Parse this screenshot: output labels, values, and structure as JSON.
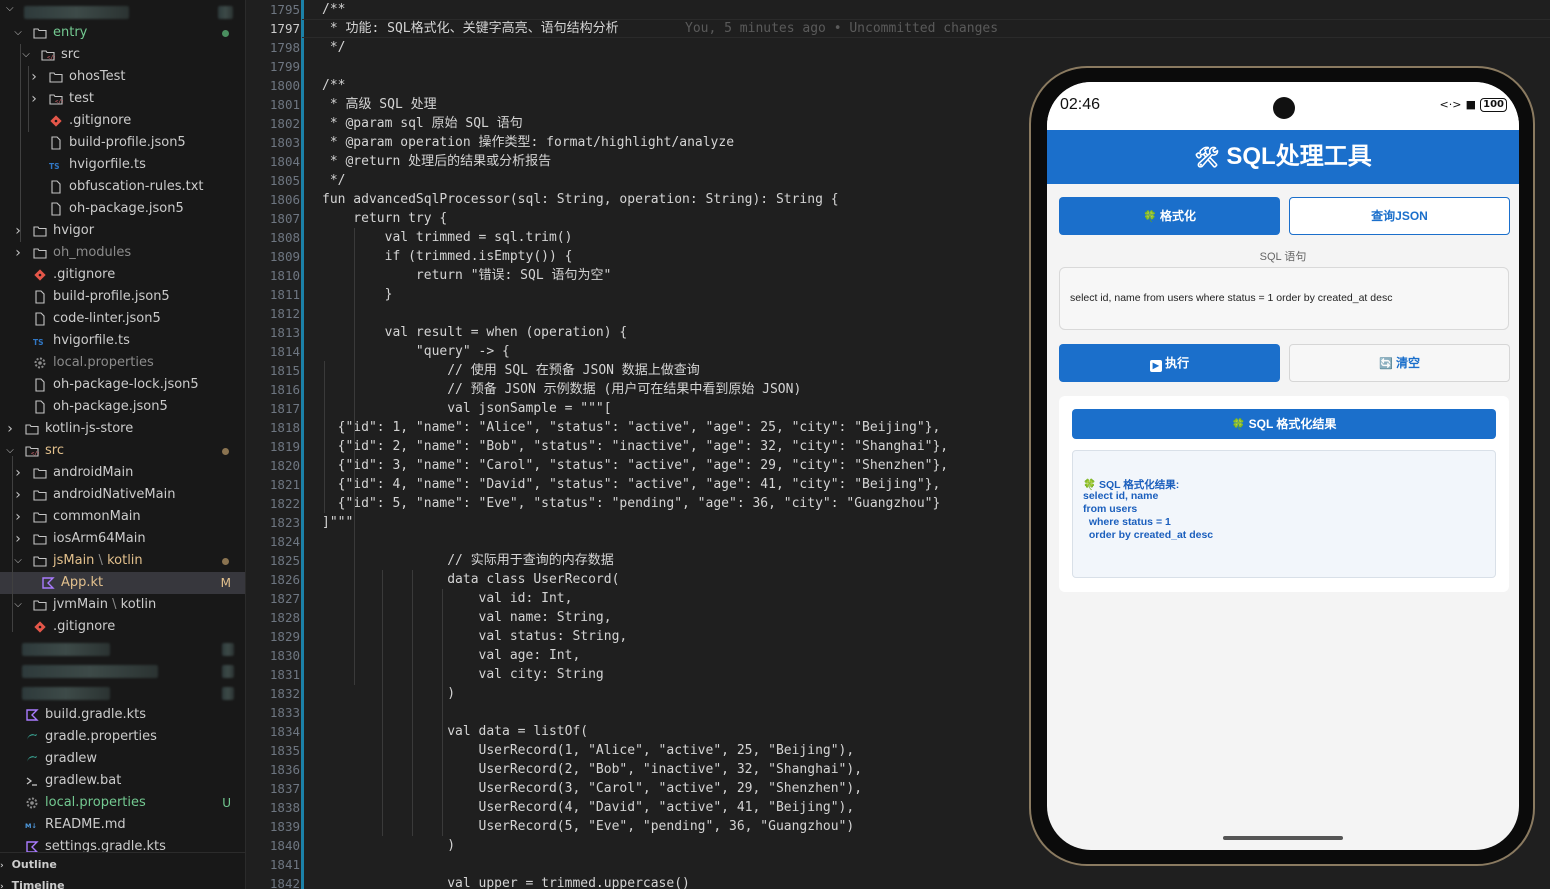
{
  "explorer": {
    "items": [
      {
        "label": "entry",
        "level": 1,
        "type": "folder",
        "expanded": true,
        "color": "#73c991",
        "status": "dot",
        "status_color": "#4a8f5f"
      },
      {
        "label": "src",
        "level": 2,
        "type": "src-folder",
        "expanded": true
      },
      {
        "label": "ohosTest",
        "level": 3,
        "type": "folder",
        "expanded": false
      },
      {
        "label": "test",
        "level": 3,
        "type": "src-folder",
        "expanded": false
      },
      {
        "label": ".gitignore",
        "level": 3,
        "type": "git"
      },
      {
        "label": "build-profile.json5",
        "level": 3,
        "type": "file"
      },
      {
        "label": "hvigorfile.ts",
        "level": 3,
        "type": "ts"
      },
      {
        "label": "obfuscation-rules.txt",
        "level": 3,
        "type": "file"
      },
      {
        "label": "oh-package.json5",
        "level": 3,
        "type": "file"
      },
      {
        "label": "hvigor",
        "level": 1,
        "type": "folder",
        "expanded": false
      },
      {
        "label": "oh_modules",
        "level": 1,
        "type": "folder",
        "expanded": false,
        "color": "#8b8b8b"
      },
      {
        "label": ".gitignore",
        "level": 1,
        "type": "git"
      },
      {
        "label": "build-profile.json5",
        "level": 1,
        "type": "file"
      },
      {
        "label": "code-linter.json5",
        "level": 1,
        "type": "file"
      },
      {
        "label": "hvigorfile.ts",
        "level": 1,
        "type": "ts"
      },
      {
        "label": "local.properties",
        "level": 1,
        "type": "gear",
        "color": "#8b8b8b"
      },
      {
        "label": "oh-package-lock.json5",
        "level": 1,
        "type": "file"
      },
      {
        "label": "oh-package.json5",
        "level": 1,
        "type": "file"
      },
      {
        "label": "kotlin-js-store",
        "level": 0,
        "type": "folder",
        "expanded": false
      },
      {
        "label": "src",
        "level": 0,
        "type": "src-folder",
        "expanded": true,
        "color": "#e2c08d",
        "status": "dot",
        "status_color": "#8a7350"
      },
      {
        "label": "androidMain",
        "level": 1,
        "type": "folder",
        "expanded": false
      },
      {
        "label": "androidNativeMain",
        "level": 1,
        "type": "folder",
        "expanded": false
      },
      {
        "label": "commonMain",
        "level": 1,
        "type": "folder",
        "expanded": false
      },
      {
        "label": "iosArm64Main",
        "level": 1,
        "type": "folder",
        "expanded": false
      },
      {
        "label": "jsMain",
        "label2": "kotlin",
        "level": 1,
        "type": "folder",
        "expanded": true,
        "color": "#e2c08d",
        "status": "dot",
        "status_color": "#8a7350"
      },
      {
        "label": "App.kt",
        "level": 2,
        "type": "kotlin",
        "selected": true,
        "color": "#e2c08d",
        "status": "M",
        "status_color": "#e2c08d"
      },
      {
        "label": "jvmMain",
        "label2": "kotlin",
        "level": 1,
        "type": "folder",
        "expanded": true
      },
      {
        "label": ".gitignore",
        "level": 1,
        "type": "git"
      },
      {
        "label": "",
        "level": 0,
        "type": "blurred"
      },
      {
        "label": "",
        "level": 0,
        "type": "blurred"
      },
      {
        "label": "",
        "level": 0,
        "type": "blurred"
      },
      {
        "label": "build.gradle.kts",
        "level": 0,
        "type": "kotlin"
      },
      {
        "label": "gradle.properties",
        "level": 0,
        "type": "gradle"
      },
      {
        "label": "gradlew",
        "level": 0,
        "type": "gradle"
      },
      {
        "label": "gradlew.bat",
        "level": 0,
        "type": "terminal"
      },
      {
        "label": "local.properties",
        "level": 0,
        "type": "gear",
        "color": "#73c991",
        "status": "U",
        "status_color": "#73c991"
      },
      {
        "label": "README.md",
        "level": 0,
        "type": "md"
      },
      {
        "label": "settings.gradle.kts",
        "level": 0,
        "type": "kotlin"
      }
    ],
    "panels": [
      "Outline",
      "Timeline"
    ]
  },
  "editor": {
    "current_line": "1797",
    "blame": "You, 5 minutes ago • Uncommitted changes",
    "lines": [
      {
        "n": "1795",
        "t": "/**"
      },
      {
        "n": "1797",
        "t": " * 功能: SQL格式化、关键字高亮、语句结构分析"
      },
      {
        "n": "1798",
        "t": " */"
      },
      {
        "n": "1799",
        "t": ""
      },
      {
        "n": "1800",
        "t": "/**"
      },
      {
        "n": "1801",
        "t": " * 高级 SQL 处理"
      },
      {
        "n": "1802",
        "t": " * @param sql 原始 SQL 语句"
      },
      {
        "n": "1803",
        "t": " * @param operation 操作类型: format/highlight/analyze"
      },
      {
        "n": "1804",
        "t": " * @return 处理后的结果或分析报告"
      },
      {
        "n": "1805",
        "t": " */"
      },
      {
        "n": "1806",
        "t": "fun advancedSqlProcessor(sql: String, operation: String): String {"
      },
      {
        "n": "1807",
        "t": "    return try {"
      },
      {
        "n": "1808",
        "t": "        val trimmed = sql.trim()"
      },
      {
        "n": "1809",
        "t": "        if (trimmed.isEmpty()) {"
      },
      {
        "n": "1810",
        "t": "            return \"错误: SQL 语句为空\""
      },
      {
        "n": "1811",
        "t": "        }"
      },
      {
        "n": "1812",
        "t": ""
      },
      {
        "n": "1813",
        "t": "        val result = when (operation) {"
      },
      {
        "n": "1814",
        "t": "            \"query\" -> {"
      },
      {
        "n": "1815",
        "t": "                // 使用 SQL 在预备 JSON 数据上做查询"
      },
      {
        "n": "1816",
        "t": "                // 预备 JSON 示例数据 (用户可在结果中看到原始 JSON)"
      },
      {
        "n": "1817",
        "t": "                val jsonSample = \"\"\"["
      },
      {
        "n": "1818",
        "t": "  {\"id\": 1, \"name\": \"Alice\", \"status\": \"active\", \"age\": 25, \"city\": \"Beijing\"},"
      },
      {
        "n": "1819",
        "t": "  {\"id\": 2, \"name\": \"Bob\", \"status\": \"inactive\", \"age\": 32, \"city\": \"Shanghai\"},"
      },
      {
        "n": "1820",
        "t": "  {\"id\": 3, \"name\": \"Carol\", \"status\": \"active\", \"age\": 29, \"city\": \"Shenzhen\"},"
      },
      {
        "n": "1821",
        "t": "  {\"id\": 4, \"name\": \"David\", \"status\": \"active\", \"age\": 41, \"city\": \"Beijing\"},"
      },
      {
        "n": "1822",
        "t": "  {\"id\": 5, \"name\": \"Eve\", \"status\": \"pending\", \"age\": 36, \"city\": \"Guangzhou\"}"
      },
      {
        "n": "1823",
        "t": "]\"\"\""
      },
      {
        "n": "1824",
        "t": ""
      },
      {
        "n": "1825",
        "t": "                // 实际用于查询的内存数据"
      },
      {
        "n": "1826",
        "t": "                data class UserRecord("
      },
      {
        "n": "1827",
        "t": "                    val id: Int,"
      },
      {
        "n": "1828",
        "t": "                    val name: String,"
      },
      {
        "n": "1829",
        "t": "                    val status: String,"
      },
      {
        "n": "1830",
        "t": "                    val age: Int,"
      },
      {
        "n": "1831",
        "t": "                    val city: String"
      },
      {
        "n": "1832",
        "t": "                )"
      },
      {
        "n": "1833",
        "t": ""
      },
      {
        "n": "1834",
        "t": "                val data = listOf("
      },
      {
        "n": "1835",
        "t": "                    UserRecord(1, \"Alice\", \"active\", 25, \"Beijing\"),"
      },
      {
        "n": "1836",
        "t": "                    UserRecord(2, \"Bob\", \"inactive\", 32, \"Shanghai\"),"
      },
      {
        "n": "1837",
        "t": "                    UserRecord(3, \"Carol\", \"active\", 29, \"Shenzhen\"),"
      },
      {
        "n": "1838",
        "t": "                    UserRecord(4, \"David\", \"active\", 41, \"Beijing\"),"
      },
      {
        "n": "1839",
        "t": "                    UserRecord(5, \"Eve\", \"pending\", 36, \"Guangzhou\")"
      },
      {
        "n": "1840",
        "t": "                )"
      },
      {
        "n": "1841",
        "t": ""
      },
      {
        "n": "1842",
        "t": "                val upper = trimmed.uppercase()"
      }
    ]
  },
  "phone": {
    "status_time": "02:46",
    "status_icons": "‹·›",
    "battery": "100",
    "app_title": "SQL处理工具",
    "title_icon": "🛠",
    "btn_format": "格式化",
    "btn_format_icon": "🍀",
    "btn_query_json": "查询JSON",
    "sql_label": "SQL 语句",
    "sql_value": "select id, name from users where status = 1 order by created_at desc",
    "btn_run": "执行",
    "btn_run_icon": "▶",
    "btn_clear": "清空",
    "btn_clear_icon": "🔄",
    "result_header": "SQL 格式化结果",
    "result_header_icon": "🍀",
    "result_lines": [
      "🍀 SQL 格式化结果:",
      "select id, name",
      "from users",
      "  where status = 1",
      "  order by created_at desc"
    ],
    "colors": {
      "accent": "#1b6fcb",
      "frame": "#8a7a60"
    }
  }
}
